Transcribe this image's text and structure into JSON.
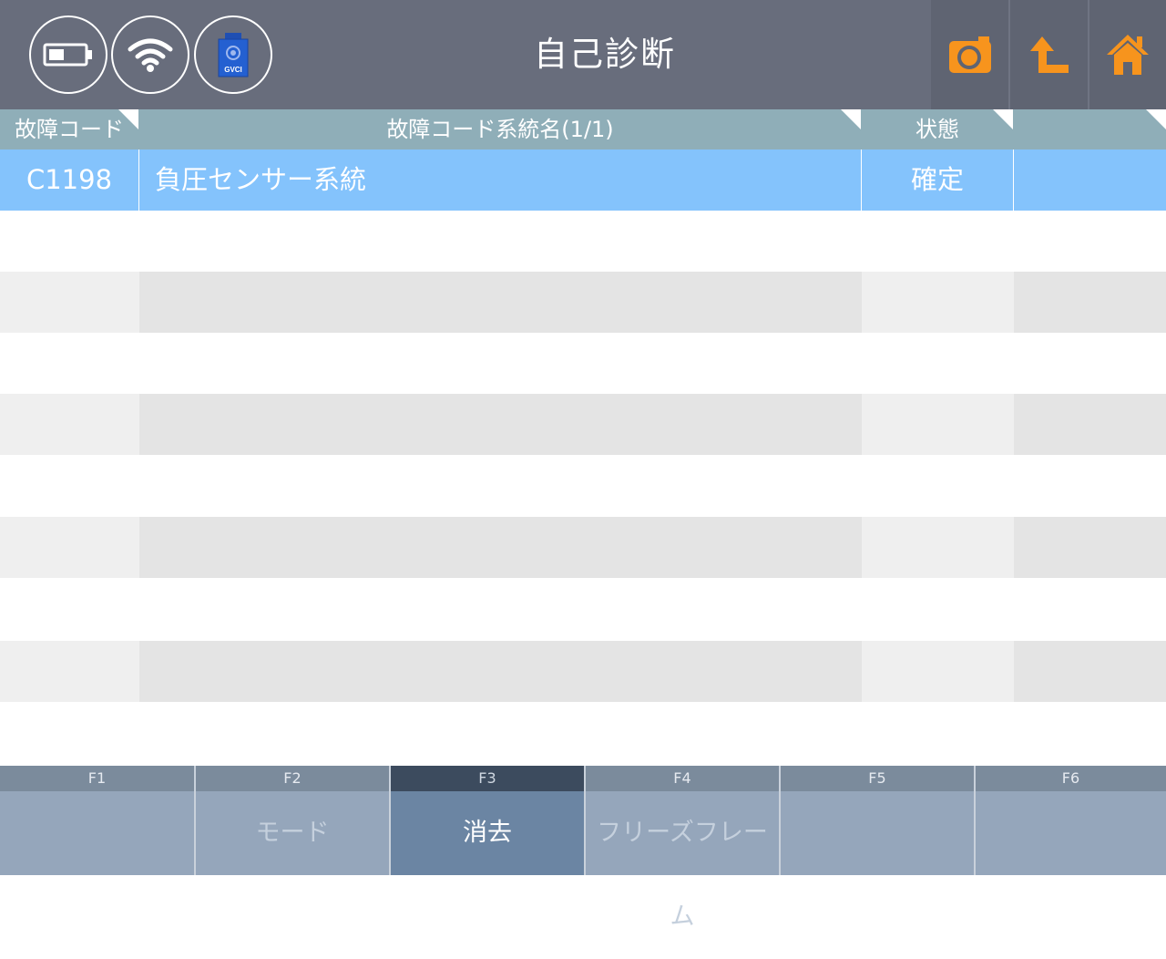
{
  "header": {
    "title": "自己診断",
    "status_icons": [
      "battery-icon",
      "wifi-icon",
      "gvci-device-icon"
    ],
    "gvci_label": "GVCI",
    "buttons": [
      "camera-icon",
      "back-arrow-icon",
      "home-icon"
    ],
    "accent_color": "#f7941d"
  },
  "table": {
    "columns": [
      "故障コード",
      "故障コード系統名(1/1)",
      "状態",
      ""
    ],
    "rows": [
      {
        "code": "C1198",
        "name": "負圧センサー系統",
        "status": "確定",
        "extra": ""
      }
    ],
    "selected_color": "#84c3fc"
  },
  "footer": {
    "keys": [
      {
        "key": "F1",
        "label": ""
      },
      {
        "key": "F2",
        "label": "モード"
      },
      {
        "key": "F3",
        "label": "消去"
      },
      {
        "key": "F4",
        "label": "フリーズフレーム"
      },
      {
        "key": "F5",
        "label": ""
      },
      {
        "key": "F6",
        "label": ""
      }
    ],
    "active_key": "F3"
  }
}
